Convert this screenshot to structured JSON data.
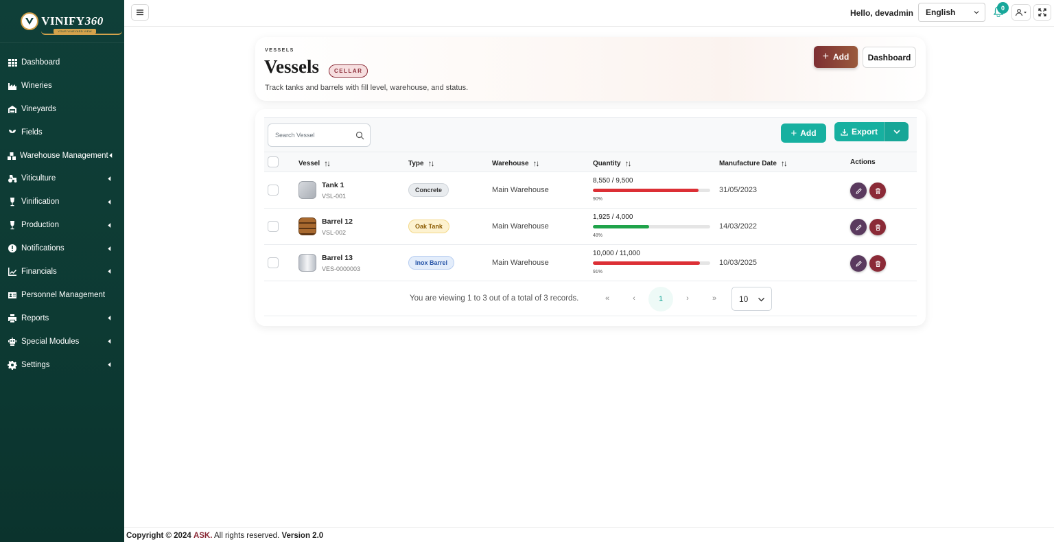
{
  "brand": {
    "name": "VINIFY",
    "number": "360",
    "tagline": "YOUR VINEYARD VIEW"
  },
  "sidebar": {
    "items": [
      {
        "label": "Dashboard",
        "icon": "dashboard-icon",
        "has_submenu": false
      },
      {
        "label": "Wineries",
        "icon": "factory-icon",
        "has_submenu": false
      },
      {
        "label": "Vineyards",
        "icon": "warehouse-icon",
        "has_submenu": false
      },
      {
        "label": "Fields",
        "icon": "seedling-icon",
        "has_submenu": false
      },
      {
        "label": "Warehouse Management",
        "icon": "boxes-icon",
        "has_submenu": true
      },
      {
        "label": "Viticulture",
        "icon": "tractor-icon",
        "has_submenu": true
      },
      {
        "label": "Vinification",
        "icon": "wine-glass-icon",
        "has_submenu": true
      },
      {
        "label": "Production",
        "icon": "wine-glass-icon",
        "has_submenu": true
      },
      {
        "label": "Notifications",
        "icon": "alert-icon",
        "has_submenu": true
      },
      {
        "label": "Financials",
        "icon": "chart-line-icon",
        "has_submenu": true
      },
      {
        "label": "Personnel Management",
        "icon": "id-card-icon",
        "has_submenu": false
      },
      {
        "label": "Reports",
        "icon": "printer-icon",
        "has_submenu": true
      },
      {
        "label": "Special Modules",
        "icon": "robot-icon",
        "has_submenu": true
      },
      {
        "label": "Settings",
        "icon": "gear-icon",
        "has_submenu": true
      }
    ]
  },
  "topbar": {
    "greeting": "Hello, devadmin",
    "language": "English",
    "notification_count": "0"
  },
  "header": {
    "eyebrow": "VESSELS",
    "title": "Vessels",
    "tag": "CELLAR",
    "description": "Track tanks and barrels with fill level, warehouse, and status.",
    "add_label": "Add",
    "dashboard_label": "Dashboard"
  },
  "toolbar": {
    "search_placeholder": "Search Vessel",
    "add_label": "Add",
    "export_label": "Export"
  },
  "table": {
    "columns": [
      "Vessel",
      "Type",
      "Warehouse",
      "Quantity",
      "Manufacture Date",
      "Actions"
    ],
    "rows": [
      {
        "name": "Tank 1",
        "code": "VSL-001",
        "type": "Concrete",
        "warehouse": "Main Warehouse",
        "quantity": "8,550 / 9,500",
        "fill": 0.9,
        "pct": "90%",
        "date": "31/05/2023"
      },
      {
        "name": "Barrel 12",
        "code": "VSL-002",
        "type": "Oak Tank",
        "warehouse": "Main Warehouse",
        "quantity": "1,925 / 4,000",
        "fill": 0.48,
        "pct": "48%",
        "date": "14/03/2022"
      },
      {
        "name": "Barrel 13",
        "code": "VES-0000003",
        "type": "Inox Barrel",
        "warehouse": "Main Warehouse",
        "quantity": "10,000 / 11,000",
        "fill": 0.91,
        "pct": "91%",
        "date": "10/03/2025"
      }
    ]
  },
  "pagination": {
    "info": "You are viewing 1 to 3 out of a total of 3 records.",
    "current_page": "1",
    "page_size": "10"
  },
  "footer": {
    "prefix": "Copyright © 2024",
    "company": "ASK.",
    "rights": "All rights reserved.",
    "version": "Version 2.0"
  },
  "colors": {
    "sidebar": "#0f3f38",
    "teal": "#17b0a0",
    "wine": "#8a2a36",
    "bar_high": "#dc2f35",
    "bar_mid": "#1fa34a"
  }
}
